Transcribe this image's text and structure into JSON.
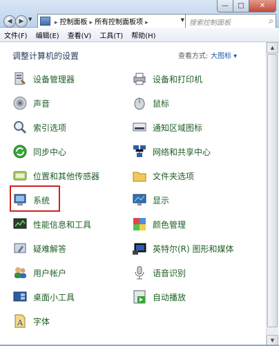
{
  "window": {
    "controls": {
      "minimize": "—",
      "maximize": "□",
      "close": "✕"
    }
  },
  "nav": {
    "back_glyph": "◀",
    "forward_glyph": "▶",
    "address": {
      "segment1": "控制面板",
      "segment2": "所有控制面板项",
      "separator": "▸"
    },
    "search_placeholder": "搜索控制面板",
    "search_icon": "search-icon"
  },
  "menu": {
    "items": [
      "文件(F)",
      "编辑(E)",
      "查看(V)",
      "工具(T)",
      "帮助(H)"
    ]
  },
  "content": {
    "heading": "调整计算机的设置",
    "view_by_label": "查看方式:",
    "view_by_value": "大图标 ▾",
    "items_left": [
      "设备管理器",
      "声音",
      "索引选项",
      "同步中心",
      "位置和其他传感器",
      "系统",
      "性能信息和工具",
      "疑难解答",
      "用户帐户",
      "桌面小工具",
      "字体"
    ],
    "items_right": [
      "设备和打印机",
      "鼠标",
      "通知区域图标",
      "网络和共享中心",
      "文件夹选项",
      "显示",
      "颜色管理",
      "英特尔(R) 图形和媒体",
      "语音识别",
      "自动播放"
    ]
  },
  "colors": {
    "item_text": "#1e5f24",
    "heading_text": "#1e395b",
    "highlight_border": "#cc2222"
  }
}
